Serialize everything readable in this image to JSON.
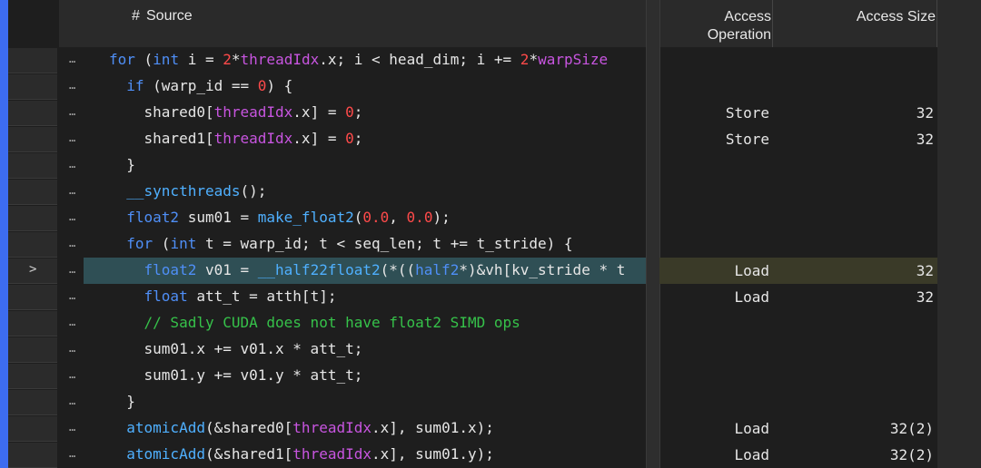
{
  "header": {
    "hash": "#",
    "source": "Source",
    "access_operation": "Access Operation",
    "access_size": "Access Size"
  },
  "selected_marker": ">",
  "row_marker": "…",
  "rows": [
    {
      "op": "",
      "size": ""
    },
    {
      "op": "",
      "size": ""
    },
    {
      "op": "Store",
      "size": "32"
    },
    {
      "op": "Store",
      "size": "32"
    },
    {
      "op": "",
      "size": ""
    },
    {
      "op": "",
      "size": ""
    },
    {
      "op": "",
      "size": ""
    },
    {
      "op": "",
      "size": ""
    },
    {
      "op": "Load",
      "size": "32",
      "selected": true
    },
    {
      "op": "Load",
      "size": "32"
    },
    {
      "op": "",
      "size": ""
    },
    {
      "op": "",
      "size": ""
    },
    {
      "op": "",
      "size": ""
    },
    {
      "op": "",
      "size": ""
    },
    {
      "op": "Load",
      "size": "32(2)"
    },
    {
      "op": "Load",
      "size": "32(2)"
    }
  ],
  "code": {
    "l0": {
      "a": "for",
      "b": " (",
      "c": "int",
      "d": " i = ",
      "e": "2",
      "f": "*",
      "g": "threadIdx",
      "h": ".x; i < head_dim; i += ",
      "i": "2",
      "j": "*",
      "k": "warpSize"
    },
    "l1": {
      "a": "  ",
      "b": "if",
      "c": " (warp_id == ",
      "d": "0",
      "e": ") {"
    },
    "l2": {
      "a": "    shared0[",
      "b": "threadIdx",
      "c": ".x] = ",
      "d": "0",
      "e": ";"
    },
    "l3": {
      "a": "    shared1[",
      "b": "threadIdx",
      "c": ".x] = ",
      "d": "0",
      "e": ";"
    },
    "l4": {
      "a": "  }"
    },
    "l5": {
      "a": "  ",
      "b": "__syncthreads",
      "c": "();"
    },
    "l6": {
      "a": "  ",
      "b": "float2",
      "c": " sum01 = ",
      "d": "make_float2",
      "e": "(",
      "f": "0.0",
      "g": ", ",
      "h": "0.0",
      "i": ");"
    },
    "l7": {
      "a": "  ",
      "b": "for",
      "c": " (",
      "d": "int",
      "e": " t = warp_id; t < seq_len; t += t_stride) {"
    },
    "l8": {
      "a": "    ",
      "b": "float2",
      "c": " v01 = ",
      "d": "__half22float2",
      "e": "(*((",
      "f": "half2",
      "g": "*)&vh[kv_stride * t"
    },
    "l9": {
      "a": "    ",
      "b": "float",
      "c": " att_t = atth[t];"
    },
    "l10": {
      "a": "    // Sadly CUDA does not have float2 SIMD ops"
    },
    "l11": {
      "a": "    sum01.x += v01.x * att_t;"
    },
    "l12": {
      "a": "    sum01.y += v01.y * att_t;"
    },
    "l13": {
      "a": "  }"
    },
    "l14": {
      "a": "  ",
      "b": "atomicAdd",
      "c": "(&shared0[",
      "d": "threadIdx",
      "e": ".x], sum01.x);"
    },
    "l15": {
      "a": "  ",
      "b": "atomicAdd",
      "c": "(&shared1[",
      "d": "threadIdx",
      "e": ".x], sum01.y);"
    }
  },
  "colors": {
    "keyword": "#4f8ff7",
    "number": "#ff4a4a",
    "member": "#c855e0",
    "function": "#4fb0ff",
    "comment": "#36c24a",
    "selected_row": "#2f4f55",
    "accent_gutter": "#3d6cf0"
  }
}
